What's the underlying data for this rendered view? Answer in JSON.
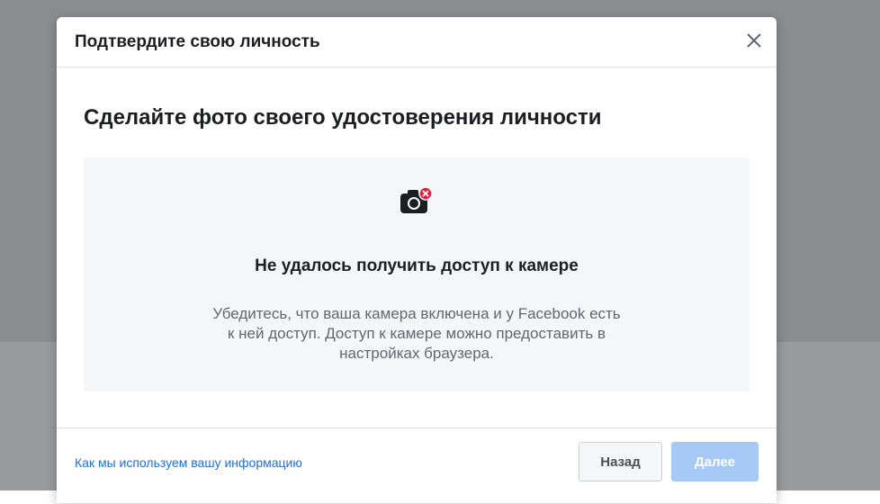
{
  "dialog": {
    "title": "Подтвердите свою личность",
    "close_icon": "close-icon"
  },
  "main": {
    "section_title": "Сделайте фото своего удостоверения личности",
    "camera": {
      "icon": "camera-error-icon",
      "error_title": "Не удалось получить доступ к камере",
      "error_desc": "Убедитесь, что ваша камера включена и у Facebook есть к ней доступ. Доступ к камере можно предоставить в настройках браузера."
    }
  },
  "footer": {
    "info_link": "Как мы используем вашу информацию",
    "back_label": "Назад",
    "next_label": "Далее"
  },
  "colors": {
    "link": "#216fdb",
    "next_disabled": "#a6c9f6",
    "error_badge": "#e41e3f"
  }
}
